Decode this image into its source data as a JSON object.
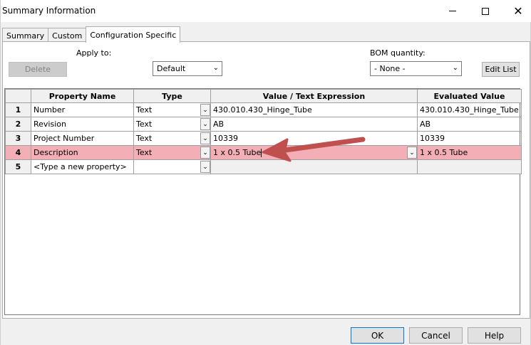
{
  "window": {
    "title": "Summary Information"
  },
  "tabs": [
    {
      "label": "Summary"
    },
    {
      "label": "Custom"
    },
    {
      "label": "Configuration Specific"
    }
  ],
  "toolbar": {
    "apply_to_label": "Apply to:",
    "delete_label": "Delete",
    "apply_to_value": "Default",
    "bom_quantity_label": "BOM quantity:",
    "bom_quantity_value": "- None -",
    "edit_list_label": "Edit List"
  },
  "table": {
    "headers": [
      "",
      "Property Name",
      "Type",
      "Value / Text Expression",
      "Evaluated Value"
    ],
    "rows": [
      {
        "num": "1",
        "name": "Number",
        "type": "Text",
        "value": "430.010.430_Hinge_Tube",
        "evaluated": "430.010.430_Hinge_Tube"
      },
      {
        "num": "2",
        "name": "Revision",
        "type": "Text",
        "value": "AB",
        "evaluated": "AB"
      },
      {
        "num": "3",
        "name": "Project Number",
        "type": "Text",
        "value": "10339",
        "evaluated": "10339"
      },
      {
        "num": "4",
        "name": "Description",
        "type": "Text",
        "value": "1 x 0.5 Tube",
        "evaluated": "1 x 0.5 Tube"
      },
      {
        "num": "5",
        "name": "<Type a new property>",
        "type": "",
        "value": "",
        "evaluated": ""
      }
    ]
  },
  "footer": {
    "ok_label": "OK",
    "cancel_label": "Cancel",
    "help_label": "Help"
  },
  "colors": {
    "highlight_row": "#f4aeb6",
    "annotation_arrow": "#c0504d"
  }
}
